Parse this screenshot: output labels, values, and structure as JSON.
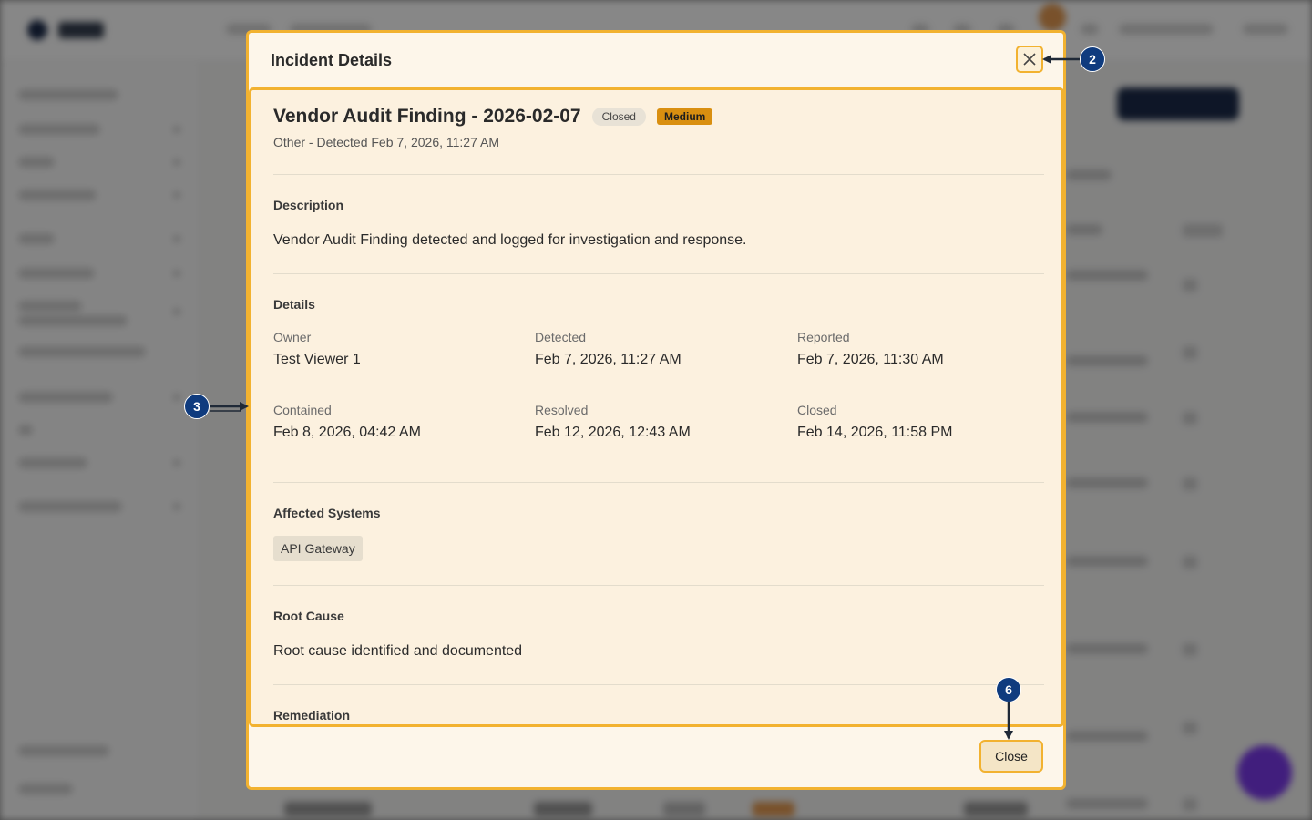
{
  "modal": {
    "title": "Incident Details",
    "close_icon": "close-icon",
    "incident": {
      "title": "Vendor Audit Finding - 2026-02-07",
      "status_badge": "Closed",
      "severity_badge": "Medium",
      "subtitle": "Other - Detected Feb 7, 2026, 11:27 AM"
    },
    "description": {
      "label": "Description",
      "text": "Vendor Audit Finding detected and logged for investigation and response."
    },
    "details": {
      "label": "Details",
      "fields": [
        {
          "label": "Owner",
          "value": "Test Viewer 1"
        },
        {
          "label": "Detected",
          "value": "Feb 7, 2026, 11:27 AM"
        },
        {
          "label": "Reported",
          "value": "Feb 7, 2026, 11:30 AM"
        },
        {
          "label": "Contained",
          "value": "Feb 8, 2026, 04:42 AM"
        },
        {
          "label": "Resolved",
          "value": "Feb 12, 2026, 12:43 AM"
        },
        {
          "label": "Closed",
          "value": "Feb 14, 2026, 11:58 PM"
        }
      ]
    },
    "affected_systems": {
      "label": "Affected Systems",
      "items": [
        "API Gateway"
      ]
    },
    "root_cause": {
      "label": "Root Cause",
      "text": "Root cause identified and documented"
    },
    "remediation": {
      "label": "Remediation"
    },
    "footer": {
      "close_label": "Close"
    }
  },
  "annotations": [
    {
      "label": "2"
    },
    {
      "label": "3"
    },
    {
      "label": "6"
    }
  ],
  "background": {
    "bottom_row_text": "2026-04-04",
    "bottom_row_type": "Violation",
    "bottom_row_time": "10:27 AM"
  },
  "colors": {
    "highlight": "#f2b230",
    "modal_bg": "#fdf6ea",
    "annotation": "#0f3b7e",
    "severity_medium": "#d98f10"
  }
}
